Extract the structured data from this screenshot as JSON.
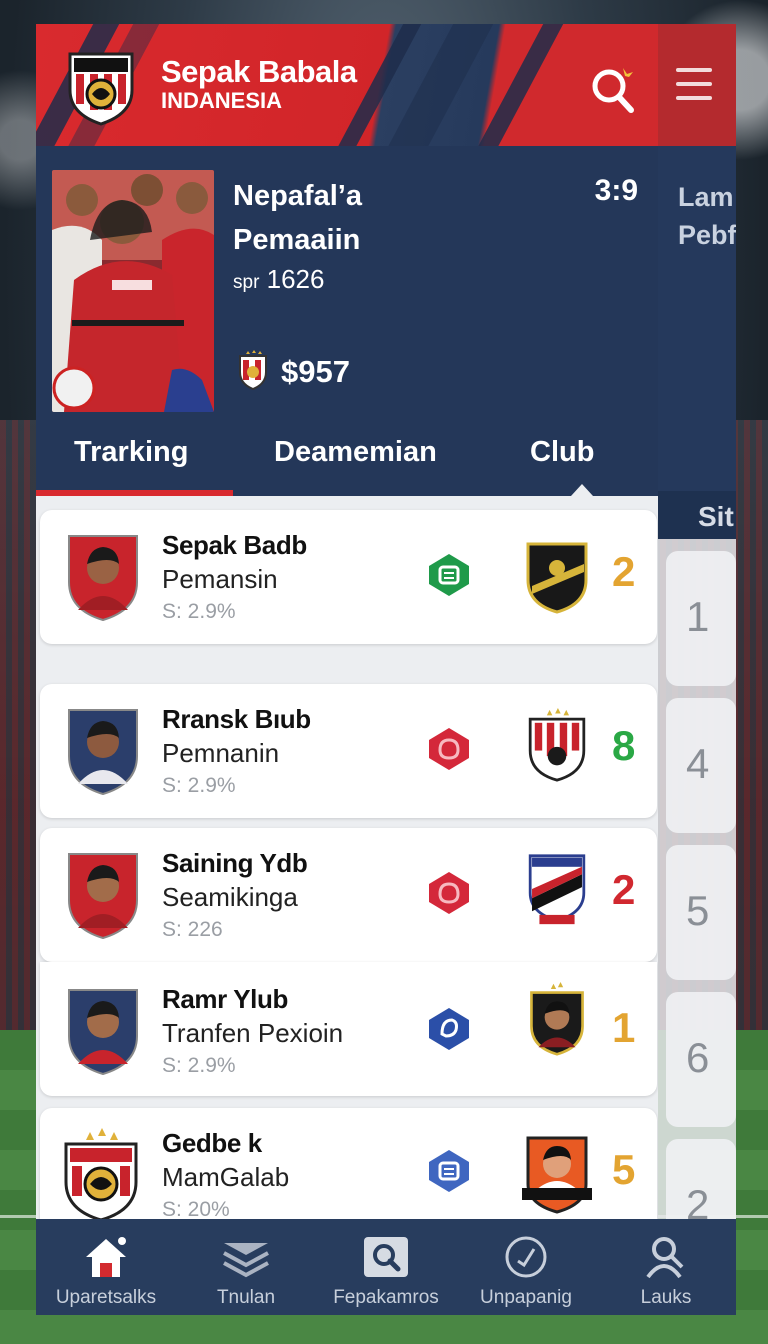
{
  "app": {
    "brand_line1": "Sepak Babala",
    "brand_line2": "INDANESIA"
  },
  "hero": {
    "name_line1": "Nepafal’a",
    "name_line2": "Pemaaiin",
    "score": "3:9",
    "sub_prefix": "spr",
    "sub_value": "1626",
    "points": "$957"
  },
  "tabs": [
    {
      "label": "Trarking"
    },
    {
      "label": "Deamemian"
    },
    {
      "label": "Club"
    },
    {
      "label": "Sit"
    }
  ],
  "side_panel": {
    "hero_line1": "Lam",
    "hero_line2": "Pebf",
    "rows": [
      "1",
      "4",
      "5",
      "6",
      "2"
    ]
  },
  "rows": [
    {
      "name": "Sepak Badb",
      "role": "Pemansin",
      "stat": "S: 2.9%",
      "score": "2",
      "score_color": "#e3a431",
      "chip_color": "#1f9a4a"
    },
    {
      "name": "Rransk Bıub",
      "role": "Pemnanin",
      "stat": "S: 2.9%",
      "score": "8",
      "score_color": "#2aa845",
      "chip_color": "#d4283a"
    },
    {
      "name": "Saining Ydb",
      "role": "Seamikinga",
      "stat": "S: 226",
      "score": "2",
      "score_color": "#d1282f",
      "chip_color": "#d4283a"
    },
    {
      "name": "Ramr Ylub",
      "role": "Tranfen Pexioin",
      "stat": "S: 2.9%",
      "score": "1",
      "score_color": "#e3a431",
      "chip_color": "#2b4fa8"
    },
    {
      "name": "Gedbe k",
      "role": "MamGalab",
      "stat": "S: 20%",
      "score": "5",
      "score_color": "#e3a431",
      "chip_color": "#3f66c0"
    }
  ],
  "bottom_nav": [
    {
      "label": "Uparetsalks",
      "icon": "home-icon"
    },
    {
      "label": "Tnulan",
      "icon": "layers-icon"
    },
    {
      "label": "Fepakamros",
      "icon": "search-icon"
    },
    {
      "label": "Unpapanig",
      "icon": "clock-icon"
    },
    {
      "label": "Lauks",
      "icon": "user-icon"
    }
  ]
}
